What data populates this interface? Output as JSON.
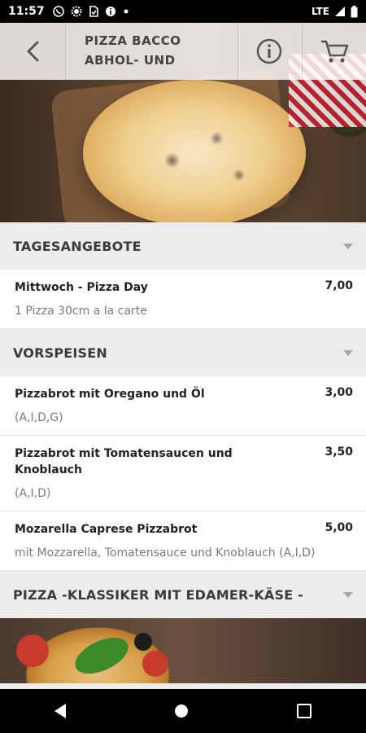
{
  "status_bar": {
    "time": "11:57",
    "network": "LTE",
    "icons": [
      "whatsapp-icon",
      "settings-icon",
      "sim-icon",
      "info-icon",
      "dot-icon",
      "signal-icon",
      "battery-icon"
    ]
  },
  "header": {
    "title_line1": "PIZZA BACCO",
    "title_line2": "ABHOL- UND"
  },
  "sections": [
    {
      "title": "TAGESANGEBOTE",
      "items": [
        {
          "name": "Mittwoch - Pizza Day",
          "price": "7,00",
          "desc": "1 Pizza 30cm a la carte"
        }
      ]
    },
    {
      "title": "VORSPEISEN",
      "items": [
        {
          "name": "Pizzabrot mit Oregano und Öl",
          "price": "3,00",
          "desc": "(A,I,D,G)"
        },
        {
          "name": "Pizzabrot mit Tomatensaucen und Knoblauch",
          "price": "3,50",
          "desc": "(A,I,D)"
        },
        {
          "name": "Mozarella Caprese Pizzabrot",
          "price": "5,00",
          "desc": "mit Mozzarella, Tomatensauce und Knoblauch (A,I,D)"
        }
      ]
    },
    {
      "title": "PIZZA -KLASSIKER MIT EDAMER-KÄSE -",
      "items": []
    }
  ],
  "colors": {
    "section_bg": "#ececec",
    "text_dark": "#222222",
    "text_muted": "#7a7a7a",
    "chevron": "#a6a6a6"
  }
}
